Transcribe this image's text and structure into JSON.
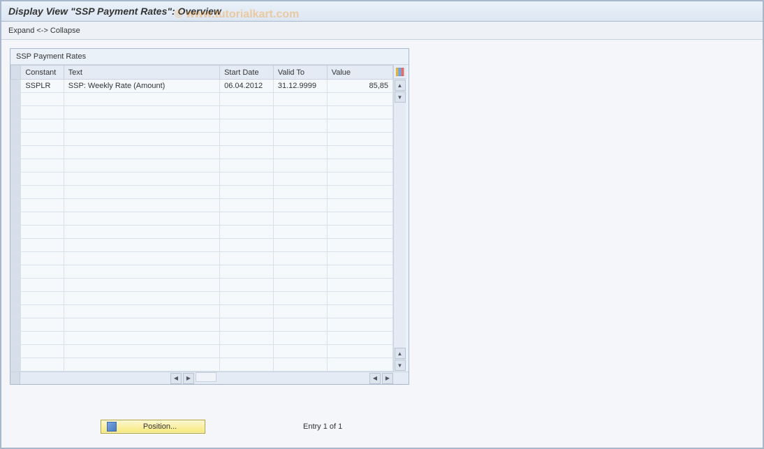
{
  "header": {
    "title": "Display View \"SSP Payment Rates\": Overview"
  },
  "toolbar": {
    "expand_collapse": "Expand <-> Collapse"
  },
  "watermark": "© www.tutorialkart.com",
  "panel": {
    "title": "SSP Payment Rates"
  },
  "columns": {
    "constant": "Constant",
    "text": "Text",
    "start_date": "Start Date",
    "valid_to": "Valid To",
    "value": "Value"
  },
  "rows": [
    {
      "constant": "SSPLR",
      "text": "SSP: Weekly Rate (Amount)",
      "start_date": "06.04.2012",
      "valid_to": "31.12.9999",
      "value": "85,85"
    }
  ],
  "footer": {
    "position_label": "Position...",
    "entry_text": "Entry 1 of 1"
  },
  "icons": {
    "config": "config-columns-icon",
    "scroll_up": "▲",
    "scroll_down": "▼",
    "scroll_left": "◀",
    "scroll_right": "▶"
  }
}
